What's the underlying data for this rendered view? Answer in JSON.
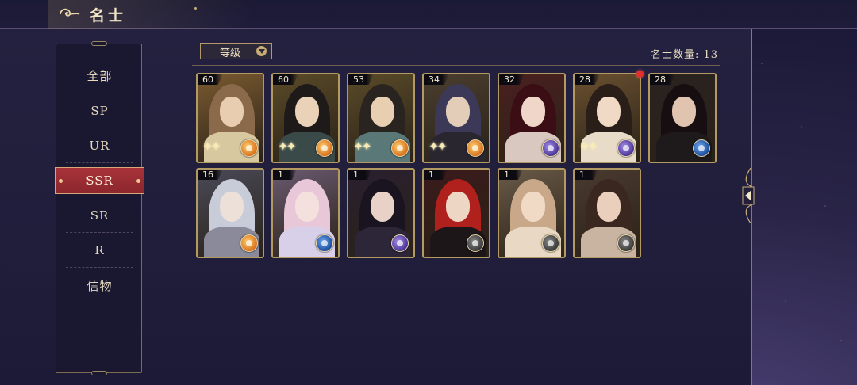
{
  "header": {
    "title": "名士"
  },
  "sidebar": {
    "items": [
      {
        "label": "全部",
        "active": false
      },
      {
        "label": "SP",
        "active": false
      },
      {
        "label": "UR",
        "active": false
      },
      {
        "label": "SSR",
        "active": true
      },
      {
        "label": "SR",
        "active": false
      },
      {
        "label": "R",
        "active": false
      },
      {
        "label": "信物",
        "active": false
      }
    ]
  },
  "filter": {
    "sort_label": "等级",
    "count_label": "名士数量: 13"
  },
  "colors": {
    "frame_gold": "#b39a63",
    "active_tab": "#a8333a",
    "notification": "#e0302c"
  },
  "cards": [
    {
      "level": "60",
      "element": "orange",
      "sparkles": true,
      "notify": false
    },
    {
      "level": "60",
      "element": "orange",
      "sparkles": true,
      "notify": false
    },
    {
      "level": "53",
      "element": "orange",
      "sparkles": true,
      "notify": false
    },
    {
      "level": "34",
      "element": "orange",
      "sparkles": true,
      "notify": false
    },
    {
      "level": "32",
      "element": "purple",
      "sparkles": false,
      "notify": false
    },
    {
      "level": "28",
      "element": "purple",
      "sparkles": true,
      "notify": true
    },
    {
      "level": "28",
      "element": "blue",
      "sparkles": false,
      "notify": false
    },
    {
      "level": "16",
      "element": "orange",
      "sparkles": false,
      "notify": false
    },
    {
      "level": "1",
      "element": "blue",
      "sparkles": false,
      "notify": false
    },
    {
      "level": "1",
      "element": "purple",
      "sparkles": false,
      "notify": false
    },
    {
      "level": "1",
      "element": "gray",
      "sparkles": false,
      "notify": false
    },
    {
      "level": "1",
      "element": "gray",
      "sparkles": false,
      "notify": false
    },
    {
      "level": "1",
      "element": "gray",
      "sparkles": false,
      "notify": false
    }
  ]
}
